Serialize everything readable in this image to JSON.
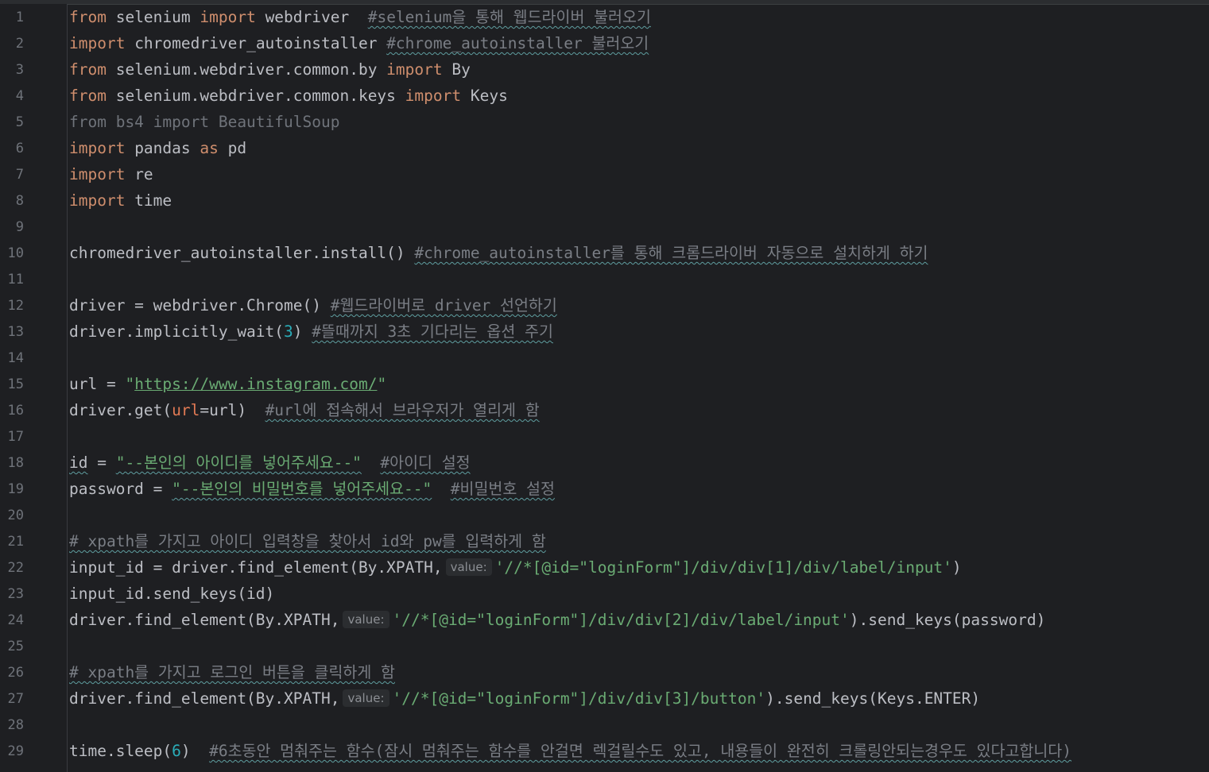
{
  "line_numbers": [
    "1",
    "2",
    "3",
    "4",
    "5",
    "6",
    "7",
    "8",
    "9",
    "10",
    "11",
    "12",
    "13",
    "14",
    "15",
    "16",
    "17",
    "18",
    "19",
    "20",
    "21",
    "22",
    "23",
    "24",
    "25",
    "26",
    "27",
    "28",
    "29"
  ],
  "hint_value": "value:",
  "code": {
    "l1": {
      "a": "from",
      "b": " selenium ",
      "c": "import",
      "d": " webdriver  ",
      "e": "#selenium을 통해 웹드라이버 불러오기"
    },
    "l2": {
      "a": "import",
      "b": " chromedriver_autoinstaller ",
      "e": "#chrome_autoinstaller 불러오기"
    },
    "l3": {
      "a": "from",
      "b": " selenium.webdriver.common.by ",
      "c": "import",
      "d": " By"
    },
    "l4": {
      "a": "from",
      "b": " selenium.webdriver.common.keys ",
      "c": "import",
      "d": " Keys"
    },
    "l5": {
      "a": "from bs4 import BeautifulSoup"
    },
    "l6": {
      "a": "import",
      "b": " pandas ",
      "c": "as",
      "d": " pd"
    },
    "l7": {
      "a": "import",
      "b": " re"
    },
    "l8": {
      "a": "import",
      "b": " time"
    },
    "l10": {
      "a": "chromedriver_autoinstaller.install() ",
      "e": "#chrome_autoinstaller를 통해 크롬드라이버 자동으로 설치하게 하기"
    },
    "l12": {
      "a": "driver = webdriver.Chrome() ",
      "e": "#웹드라이버로 driver 선언하기"
    },
    "l13": {
      "a": "driver.implicitly_wait(",
      "n": "3",
      "b": ") ",
      "e": "#뜰때까지 3초 기다리는 옵션 주기"
    },
    "l15": {
      "a": "url = ",
      "q1": "\"",
      "u": "https://www.instagram.com/",
      "q2": "\""
    },
    "l16": {
      "a": "driver.get(",
      "p": "url",
      "b": "=url)  ",
      "e": "#url에 접속해서 브라우저가 열리게 함"
    },
    "l18": {
      "a": "id",
      "b": " = ",
      "s": "\"--본인의 아이디를 넣어주세요--\"",
      "sp": "  ",
      "e": "#아이디 설정"
    },
    "l19": {
      "a": "password = ",
      "s": "\"--본인의 비밀번호를 넣어주세요--\"",
      "sp": "  ",
      "e": "#비밀번호 설정"
    },
    "l21": {
      "e": "# xpath를 가지고 아이디 입력창을 찾아서 id와 pw를 입력하게 함"
    },
    "l22": {
      "a": "input_id = driver.find_element(By.XPATH,",
      "s": "'//*[@id=\"loginForm\"]/div/div[1]/div/label/input'",
      "b": ")"
    },
    "l23": {
      "a": "input_id.send_keys(id)"
    },
    "l24": {
      "a": "driver.find_element(By.XPATH,",
      "s": "'//*[@id=\"loginForm\"]/div/div[2]/div/label/input'",
      "b": ").send_keys(password)"
    },
    "l26": {
      "e": "# xpath를 가지고 로그인 버튼을 클릭하게 함"
    },
    "l27": {
      "a": "driver.find_element(By.XPATH,",
      "s": "'//*[@id=\"loginForm\"]/div/div[3]/button'",
      "b": ").send_keys(Keys.ENTER)"
    },
    "l29": {
      "a": "time.sleep(",
      "n": "6",
      "b": ")  ",
      "e": "#6초동안 멈춰주는 함수(잠시 멈춰주는 함수를 안걸면 렉걸릴수도 있고, 내용들이 완전히 크롤링안되는경우도 있다고합니다)"
    }
  },
  "colors": {
    "background": "#1e1f22",
    "keyword": "#cf8e6d",
    "string": "#6aab73",
    "number": "#2aacb8",
    "comment": "#7a7e85",
    "text": "#bcbec4"
  }
}
